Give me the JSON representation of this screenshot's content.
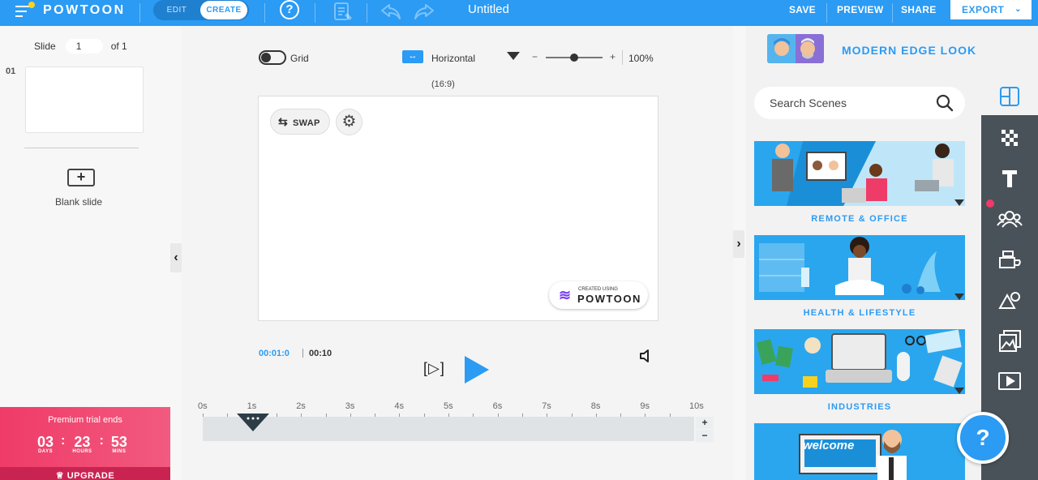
{
  "topbar": {
    "logo": "POWTOON",
    "mode_edit": "EDIT",
    "mode_create": "CREATE",
    "help": "?",
    "title": "Untitled",
    "save": "SAVE",
    "preview": "PREVIEW",
    "share": "SHARE",
    "export": "EXPORT",
    "accent_color": "#2b9bf4"
  },
  "left": {
    "slide_label": "Slide",
    "slide_value": "1",
    "slide_of": "of 1",
    "slide_number": "01",
    "blank_slide": "Blank slide"
  },
  "trial": {
    "title": "Premium trial ends",
    "days": "03",
    "hours": "23",
    "mins": "53",
    "days_label": "DAYS",
    "hours_label": "HOURS",
    "mins_label": "MINS",
    "upgrade": "UPGRADE"
  },
  "canvas": {
    "grid_label": "Grid",
    "orientation": "Horizontal",
    "zoom_minus": "−",
    "zoom_plus": "+",
    "zoom": "100%",
    "zoom_level": 0.5,
    "ratio": "(16:9)",
    "swap": "SWAP",
    "watermark_small": "CREATED USING",
    "watermark_big": "POWTOON"
  },
  "player": {
    "current": "00:01:0",
    "total": "00:10",
    "ruler": [
      "0s",
      "1s",
      "2s",
      "3s",
      "4s",
      "5s",
      "6s",
      "7s",
      "8s",
      "9s",
      "10s"
    ],
    "zoom_in": "+",
    "zoom_out": "−"
  },
  "right": {
    "look": "MODERN EDGE LOOK",
    "search_placeholder": "Search Scenes",
    "scenes": [
      {
        "label": "REMOTE & OFFICE"
      },
      {
        "label": "HEALTH & LIFESTYLE"
      },
      {
        "label": "INDUSTRIES"
      },
      {
        "label": "welcome"
      }
    ]
  },
  "rail": {
    "icons": [
      "layout-icon",
      "background-icon",
      "text-icon",
      "characters-icon",
      "props-icon",
      "shapes-icon",
      "images-icon",
      "video-icon"
    ]
  },
  "help_fab": "?"
}
